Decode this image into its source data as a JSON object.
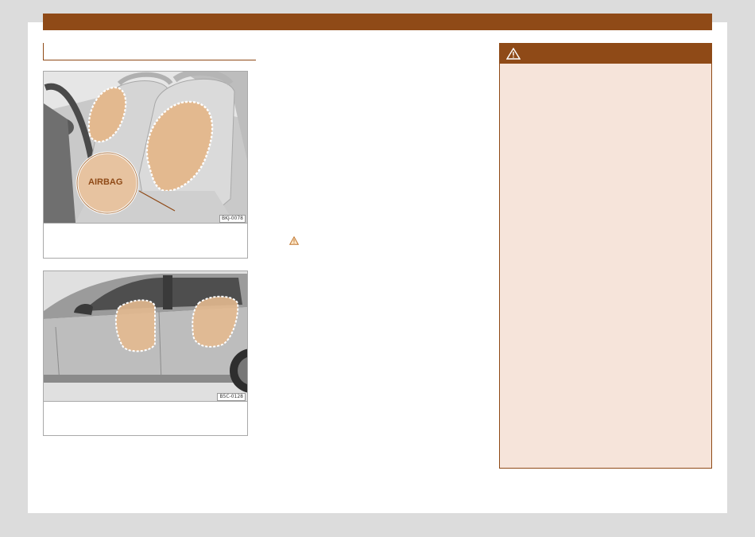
{
  "header": {
    "band_color": "#8f4a17"
  },
  "section": {
    "title": ""
  },
  "figures": [
    {
      "code": "BKJ-0078",
      "callout_label": "AIRBAG",
      "caption": "",
      "highlight_color": "#e3b98f"
    },
    {
      "code": "B5C-0128",
      "caption": "",
      "highlight_color": "#e3b98f"
    }
  ],
  "body_text": {
    "inline_icon": "warning-triangle-icon"
  },
  "warning_box": {
    "icon": "warning-triangle-icon",
    "title": "",
    "background": "#f6e4da",
    "header_color": "#8f4a17"
  }
}
